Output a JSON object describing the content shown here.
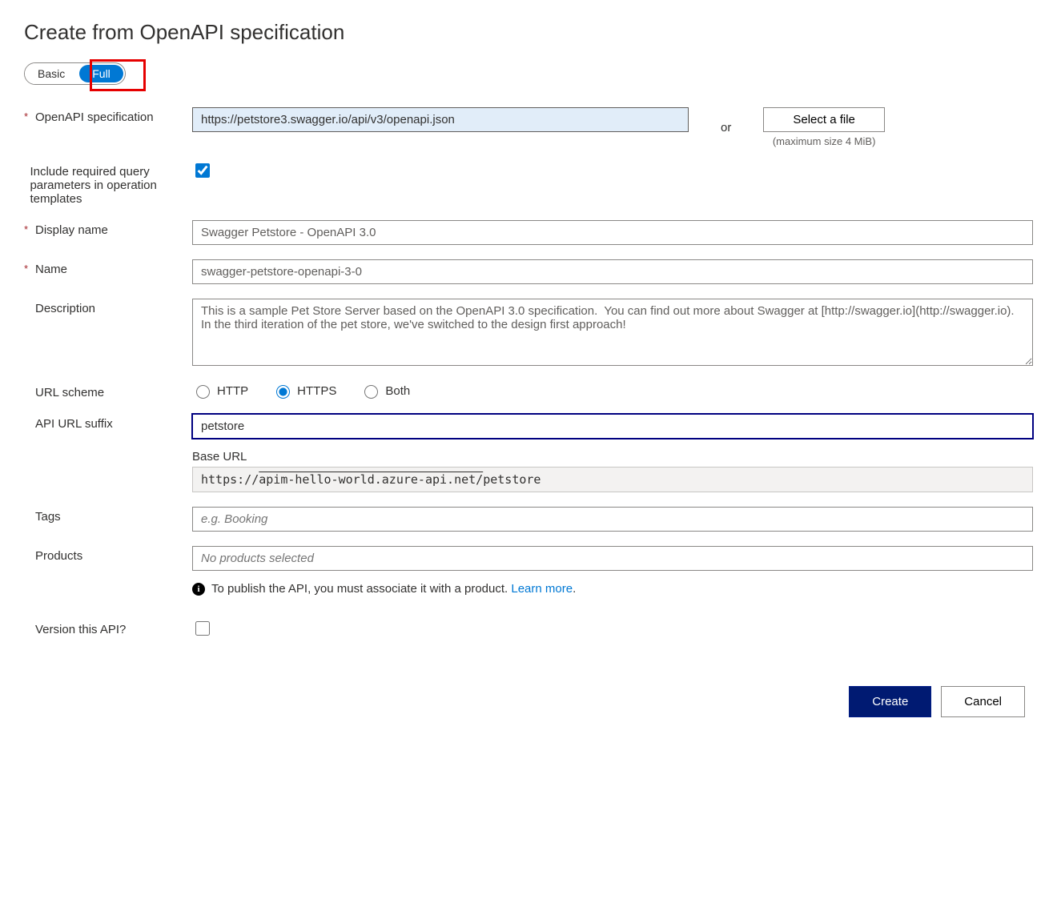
{
  "title": "Create from OpenAPI specification",
  "toggle": {
    "basic": "Basic",
    "full": "Full"
  },
  "labels": {
    "spec": "OpenAPI specification",
    "include": "Include required query parameters in operation templates",
    "displayName": "Display name",
    "name": "Name",
    "description": "Description",
    "urlScheme": "URL scheme",
    "suffix": "API URL suffix",
    "baseUrl": "Base URL",
    "tags": "Tags",
    "products": "Products",
    "version": "Version this API?"
  },
  "fields": {
    "specValue": "https://petstore3.swagger.io/api/v3/openapi.json",
    "or": "or",
    "selectFile": "Select a file",
    "maxSize": "(maximum size 4 MiB)",
    "includeChecked": true,
    "displayName": "Swagger Petstore - OpenAPI 3.0",
    "name": "swagger-petstore-openapi-3-0",
    "description": "This is a sample Pet Store Server based on the OpenAPI 3.0 specification.  You can find out more about Swagger at [http://swagger.io](http://swagger.io). In the third iteration of the pet store, we've switched to the design first approach!",
    "scheme": {
      "http": "HTTP",
      "https": "HTTPS",
      "both": "Both",
      "selected": "https"
    },
    "suffix": "petstore",
    "baseUrlPrefix": "https://",
    "baseUrlHost": "apim-hello-world.azure-api.net/",
    "baseUrlSuffix": "petstore",
    "tagsPlaceholder": "e.g. Booking",
    "productsPlaceholder": "No products selected",
    "productInfo": "To publish the API, you must associate it with a product. ",
    "learnMore": "Learn more",
    "versionChecked": false
  },
  "actions": {
    "create": "Create",
    "cancel": "Cancel"
  }
}
